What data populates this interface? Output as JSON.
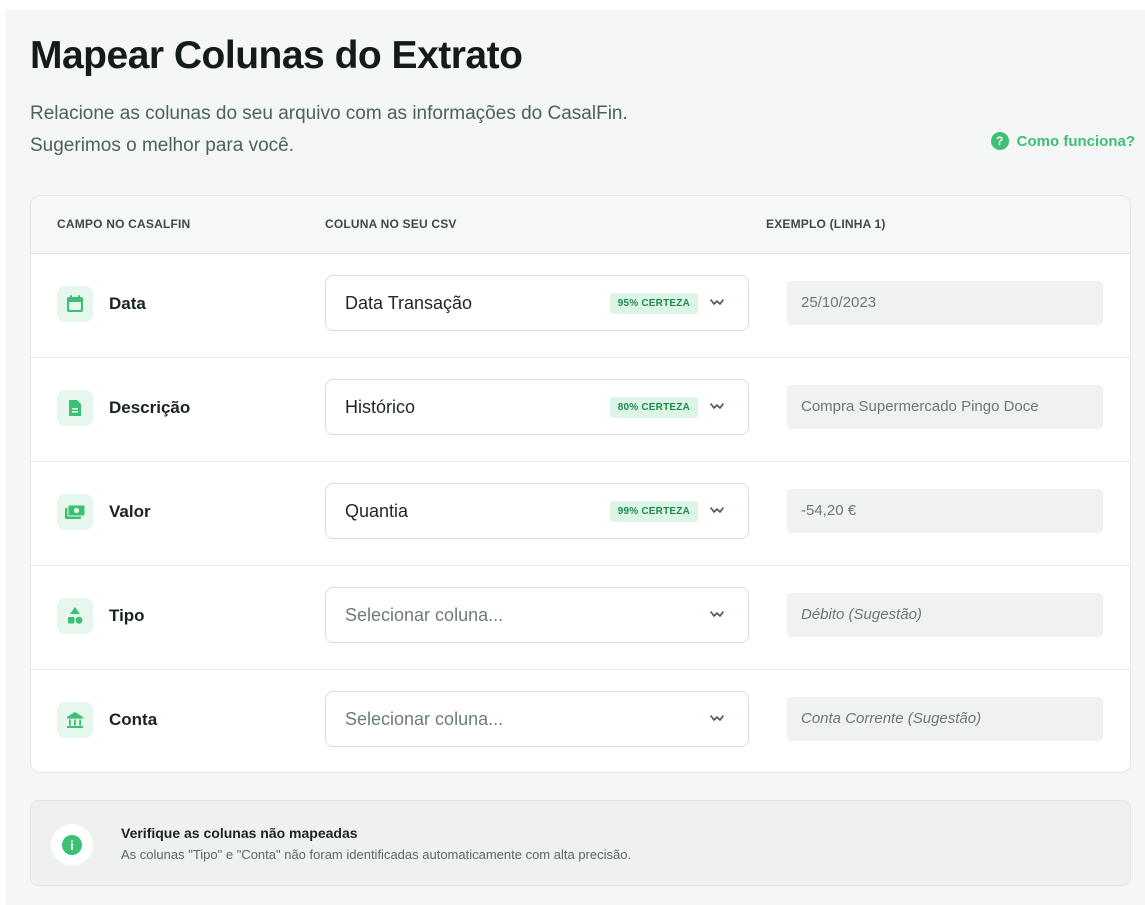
{
  "header": {
    "title": "Mapear Colunas do Extrato",
    "subtitle_line1": "Relacione as colunas do seu arquivo com as informações do CasalFin.",
    "subtitle_line2": "Sugerimos o melhor para você.",
    "help_label": "Como funciona?",
    "help_icon": "question-circle-icon"
  },
  "table": {
    "columns": {
      "field": "CAMPO NO CASALFIN",
      "csv_column": "COLUNA NO SEU CSV",
      "example": "EXEMPLO (LINHA 1)"
    },
    "rows": [
      {
        "field": "Data",
        "icon": "calendar-icon",
        "selected": "Data Transação",
        "confidence": "95% CERTEZA",
        "example": "25/10/2023"
      },
      {
        "field": "Descrição",
        "icon": "document-icon",
        "selected": "Histórico",
        "confidence": "80% CERTEZA",
        "example": "Compra Supermercado Pingo Doce"
      },
      {
        "field": "Valor",
        "icon": "money-icon",
        "selected": "Quantia",
        "confidence": "99% CERTEZA",
        "example": "-54,20 €"
      },
      {
        "field": "Tipo",
        "icon": "category-icon",
        "placeholder": "Selecionar coluna...",
        "example": "Débito (Sugestão)"
      },
      {
        "field": "Conta",
        "icon": "bank-icon",
        "placeholder": "Selecionar coluna...",
        "example": "Conta Corrente (Sugestão)"
      }
    ]
  },
  "notice": {
    "icon": "info-icon",
    "title": "Verifique as colunas não mapeadas",
    "text": "As colunas \"Tipo\" e \"Conta\" não foram identificadas automaticamente com alta precisão."
  },
  "colors": {
    "accent": "#3cc073",
    "badge_bg": "#ddf5e7",
    "badge_text": "#1d8a4c",
    "icon_tile": "#e6f7ee"
  }
}
